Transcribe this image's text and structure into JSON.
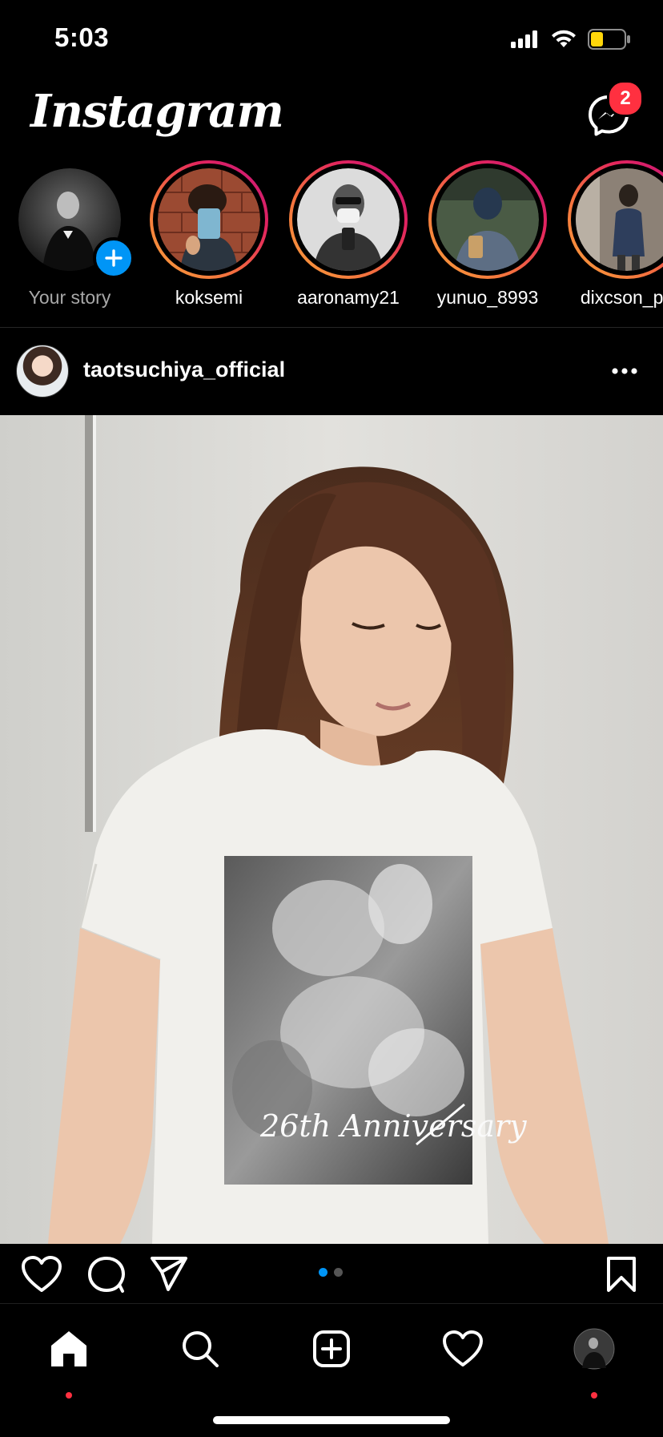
{
  "status_bar": {
    "time": "5:03",
    "battery_color": "#ffd60a"
  },
  "header": {
    "logo_text": "Instagram",
    "messenger_icon": "messenger-icon",
    "unread_count": "2"
  },
  "stories": [
    {
      "name": "Your story",
      "own": true
    },
    {
      "name": "koksemi"
    },
    {
      "name": "aaronamy21"
    },
    {
      "name": "yunuo_8993"
    },
    {
      "name": "dixcson_pa"
    }
  ],
  "post": {
    "username": "taotsuchiya_official",
    "photo_text": "26th Anniversary",
    "carousel": {
      "count": 2,
      "active": 1
    }
  },
  "colors": {
    "accent": "#0095f6",
    "badge": "#ff3040",
    "background": "#000000"
  },
  "tabs": [
    "home-icon",
    "search-icon",
    "new-post-icon",
    "activity-heart-icon",
    "profile-avatar"
  ]
}
